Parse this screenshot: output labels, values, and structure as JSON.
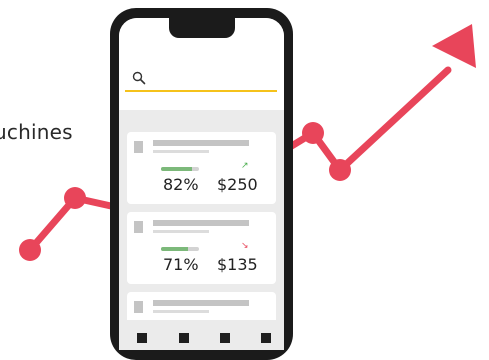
{
  "side_text": "uchines",
  "search": {
    "icon": "search-icon",
    "underline_color": "#f5c21b"
  },
  "colors": {
    "trend_line": "#e8455a",
    "phone_frame": "#1b1b1b",
    "progress_fill": "#7cb97a"
  },
  "cards": [
    {
      "percent": "82%",
      "progress": 0.82,
      "amount": "$250",
      "trend": "up",
      "trend_glyph": "↗"
    },
    {
      "percent": "71%",
      "progress": 0.71,
      "amount": "$135",
      "trend": "down",
      "trend_glyph": "↘"
    },
    {
      "percent": "",
      "progress": null,
      "amount": "",
      "trend": "",
      "trend_glyph": ""
    }
  ],
  "bottom_nav": {
    "items": [
      "nav-item-1",
      "nav-item-2",
      "nav-item-3",
      "nav-item-4"
    ]
  }
}
